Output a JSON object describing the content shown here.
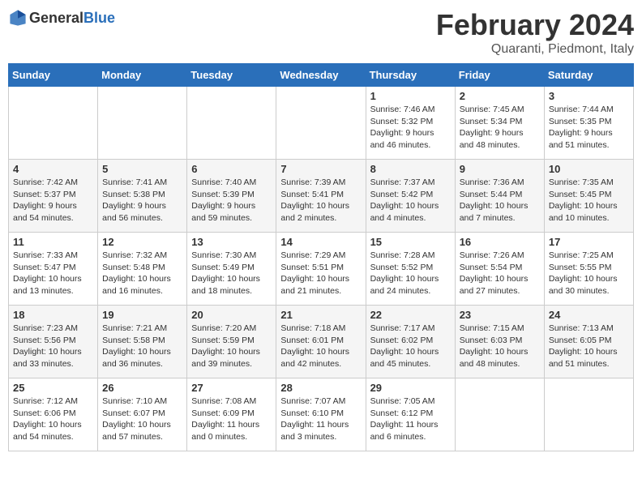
{
  "logo": {
    "general": "General",
    "blue": "Blue"
  },
  "title": {
    "month_year": "February 2024",
    "location": "Quaranti, Piedmont, Italy"
  },
  "days_of_week": [
    "Sunday",
    "Monday",
    "Tuesday",
    "Wednesday",
    "Thursday",
    "Friday",
    "Saturday"
  ],
  "weeks": [
    [
      {
        "day": "",
        "info": ""
      },
      {
        "day": "",
        "info": ""
      },
      {
        "day": "",
        "info": ""
      },
      {
        "day": "",
        "info": ""
      },
      {
        "day": "1",
        "info": "Sunrise: 7:46 AM\nSunset: 5:32 PM\nDaylight: 9 hours\nand 46 minutes."
      },
      {
        "day": "2",
        "info": "Sunrise: 7:45 AM\nSunset: 5:34 PM\nDaylight: 9 hours\nand 48 minutes."
      },
      {
        "day": "3",
        "info": "Sunrise: 7:44 AM\nSunset: 5:35 PM\nDaylight: 9 hours\nand 51 minutes."
      }
    ],
    [
      {
        "day": "4",
        "info": "Sunrise: 7:42 AM\nSunset: 5:37 PM\nDaylight: 9 hours\nand 54 minutes."
      },
      {
        "day": "5",
        "info": "Sunrise: 7:41 AM\nSunset: 5:38 PM\nDaylight: 9 hours\nand 56 minutes."
      },
      {
        "day": "6",
        "info": "Sunrise: 7:40 AM\nSunset: 5:39 PM\nDaylight: 9 hours\nand 59 minutes."
      },
      {
        "day": "7",
        "info": "Sunrise: 7:39 AM\nSunset: 5:41 PM\nDaylight: 10 hours\nand 2 minutes."
      },
      {
        "day": "8",
        "info": "Sunrise: 7:37 AM\nSunset: 5:42 PM\nDaylight: 10 hours\nand 4 minutes."
      },
      {
        "day": "9",
        "info": "Sunrise: 7:36 AM\nSunset: 5:44 PM\nDaylight: 10 hours\nand 7 minutes."
      },
      {
        "day": "10",
        "info": "Sunrise: 7:35 AM\nSunset: 5:45 PM\nDaylight: 10 hours\nand 10 minutes."
      }
    ],
    [
      {
        "day": "11",
        "info": "Sunrise: 7:33 AM\nSunset: 5:47 PM\nDaylight: 10 hours\nand 13 minutes."
      },
      {
        "day": "12",
        "info": "Sunrise: 7:32 AM\nSunset: 5:48 PM\nDaylight: 10 hours\nand 16 minutes."
      },
      {
        "day": "13",
        "info": "Sunrise: 7:30 AM\nSunset: 5:49 PM\nDaylight: 10 hours\nand 18 minutes."
      },
      {
        "day": "14",
        "info": "Sunrise: 7:29 AM\nSunset: 5:51 PM\nDaylight: 10 hours\nand 21 minutes."
      },
      {
        "day": "15",
        "info": "Sunrise: 7:28 AM\nSunset: 5:52 PM\nDaylight: 10 hours\nand 24 minutes."
      },
      {
        "day": "16",
        "info": "Sunrise: 7:26 AM\nSunset: 5:54 PM\nDaylight: 10 hours\nand 27 minutes."
      },
      {
        "day": "17",
        "info": "Sunrise: 7:25 AM\nSunset: 5:55 PM\nDaylight: 10 hours\nand 30 minutes."
      }
    ],
    [
      {
        "day": "18",
        "info": "Sunrise: 7:23 AM\nSunset: 5:56 PM\nDaylight: 10 hours\nand 33 minutes."
      },
      {
        "day": "19",
        "info": "Sunrise: 7:21 AM\nSunset: 5:58 PM\nDaylight: 10 hours\nand 36 minutes."
      },
      {
        "day": "20",
        "info": "Sunrise: 7:20 AM\nSunset: 5:59 PM\nDaylight: 10 hours\nand 39 minutes."
      },
      {
        "day": "21",
        "info": "Sunrise: 7:18 AM\nSunset: 6:01 PM\nDaylight: 10 hours\nand 42 minutes."
      },
      {
        "day": "22",
        "info": "Sunrise: 7:17 AM\nSunset: 6:02 PM\nDaylight: 10 hours\nand 45 minutes."
      },
      {
        "day": "23",
        "info": "Sunrise: 7:15 AM\nSunset: 6:03 PM\nDaylight: 10 hours\nand 48 minutes."
      },
      {
        "day": "24",
        "info": "Sunrise: 7:13 AM\nSunset: 6:05 PM\nDaylight: 10 hours\nand 51 minutes."
      }
    ],
    [
      {
        "day": "25",
        "info": "Sunrise: 7:12 AM\nSunset: 6:06 PM\nDaylight: 10 hours\nand 54 minutes."
      },
      {
        "day": "26",
        "info": "Sunrise: 7:10 AM\nSunset: 6:07 PM\nDaylight: 10 hours\nand 57 minutes."
      },
      {
        "day": "27",
        "info": "Sunrise: 7:08 AM\nSunset: 6:09 PM\nDaylight: 11 hours\nand 0 minutes."
      },
      {
        "day": "28",
        "info": "Sunrise: 7:07 AM\nSunset: 6:10 PM\nDaylight: 11 hours\nand 3 minutes."
      },
      {
        "day": "29",
        "info": "Sunrise: 7:05 AM\nSunset: 6:12 PM\nDaylight: 11 hours\nand 6 minutes."
      },
      {
        "day": "",
        "info": ""
      },
      {
        "day": "",
        "info": ""
      }
    ]
  ]
}
